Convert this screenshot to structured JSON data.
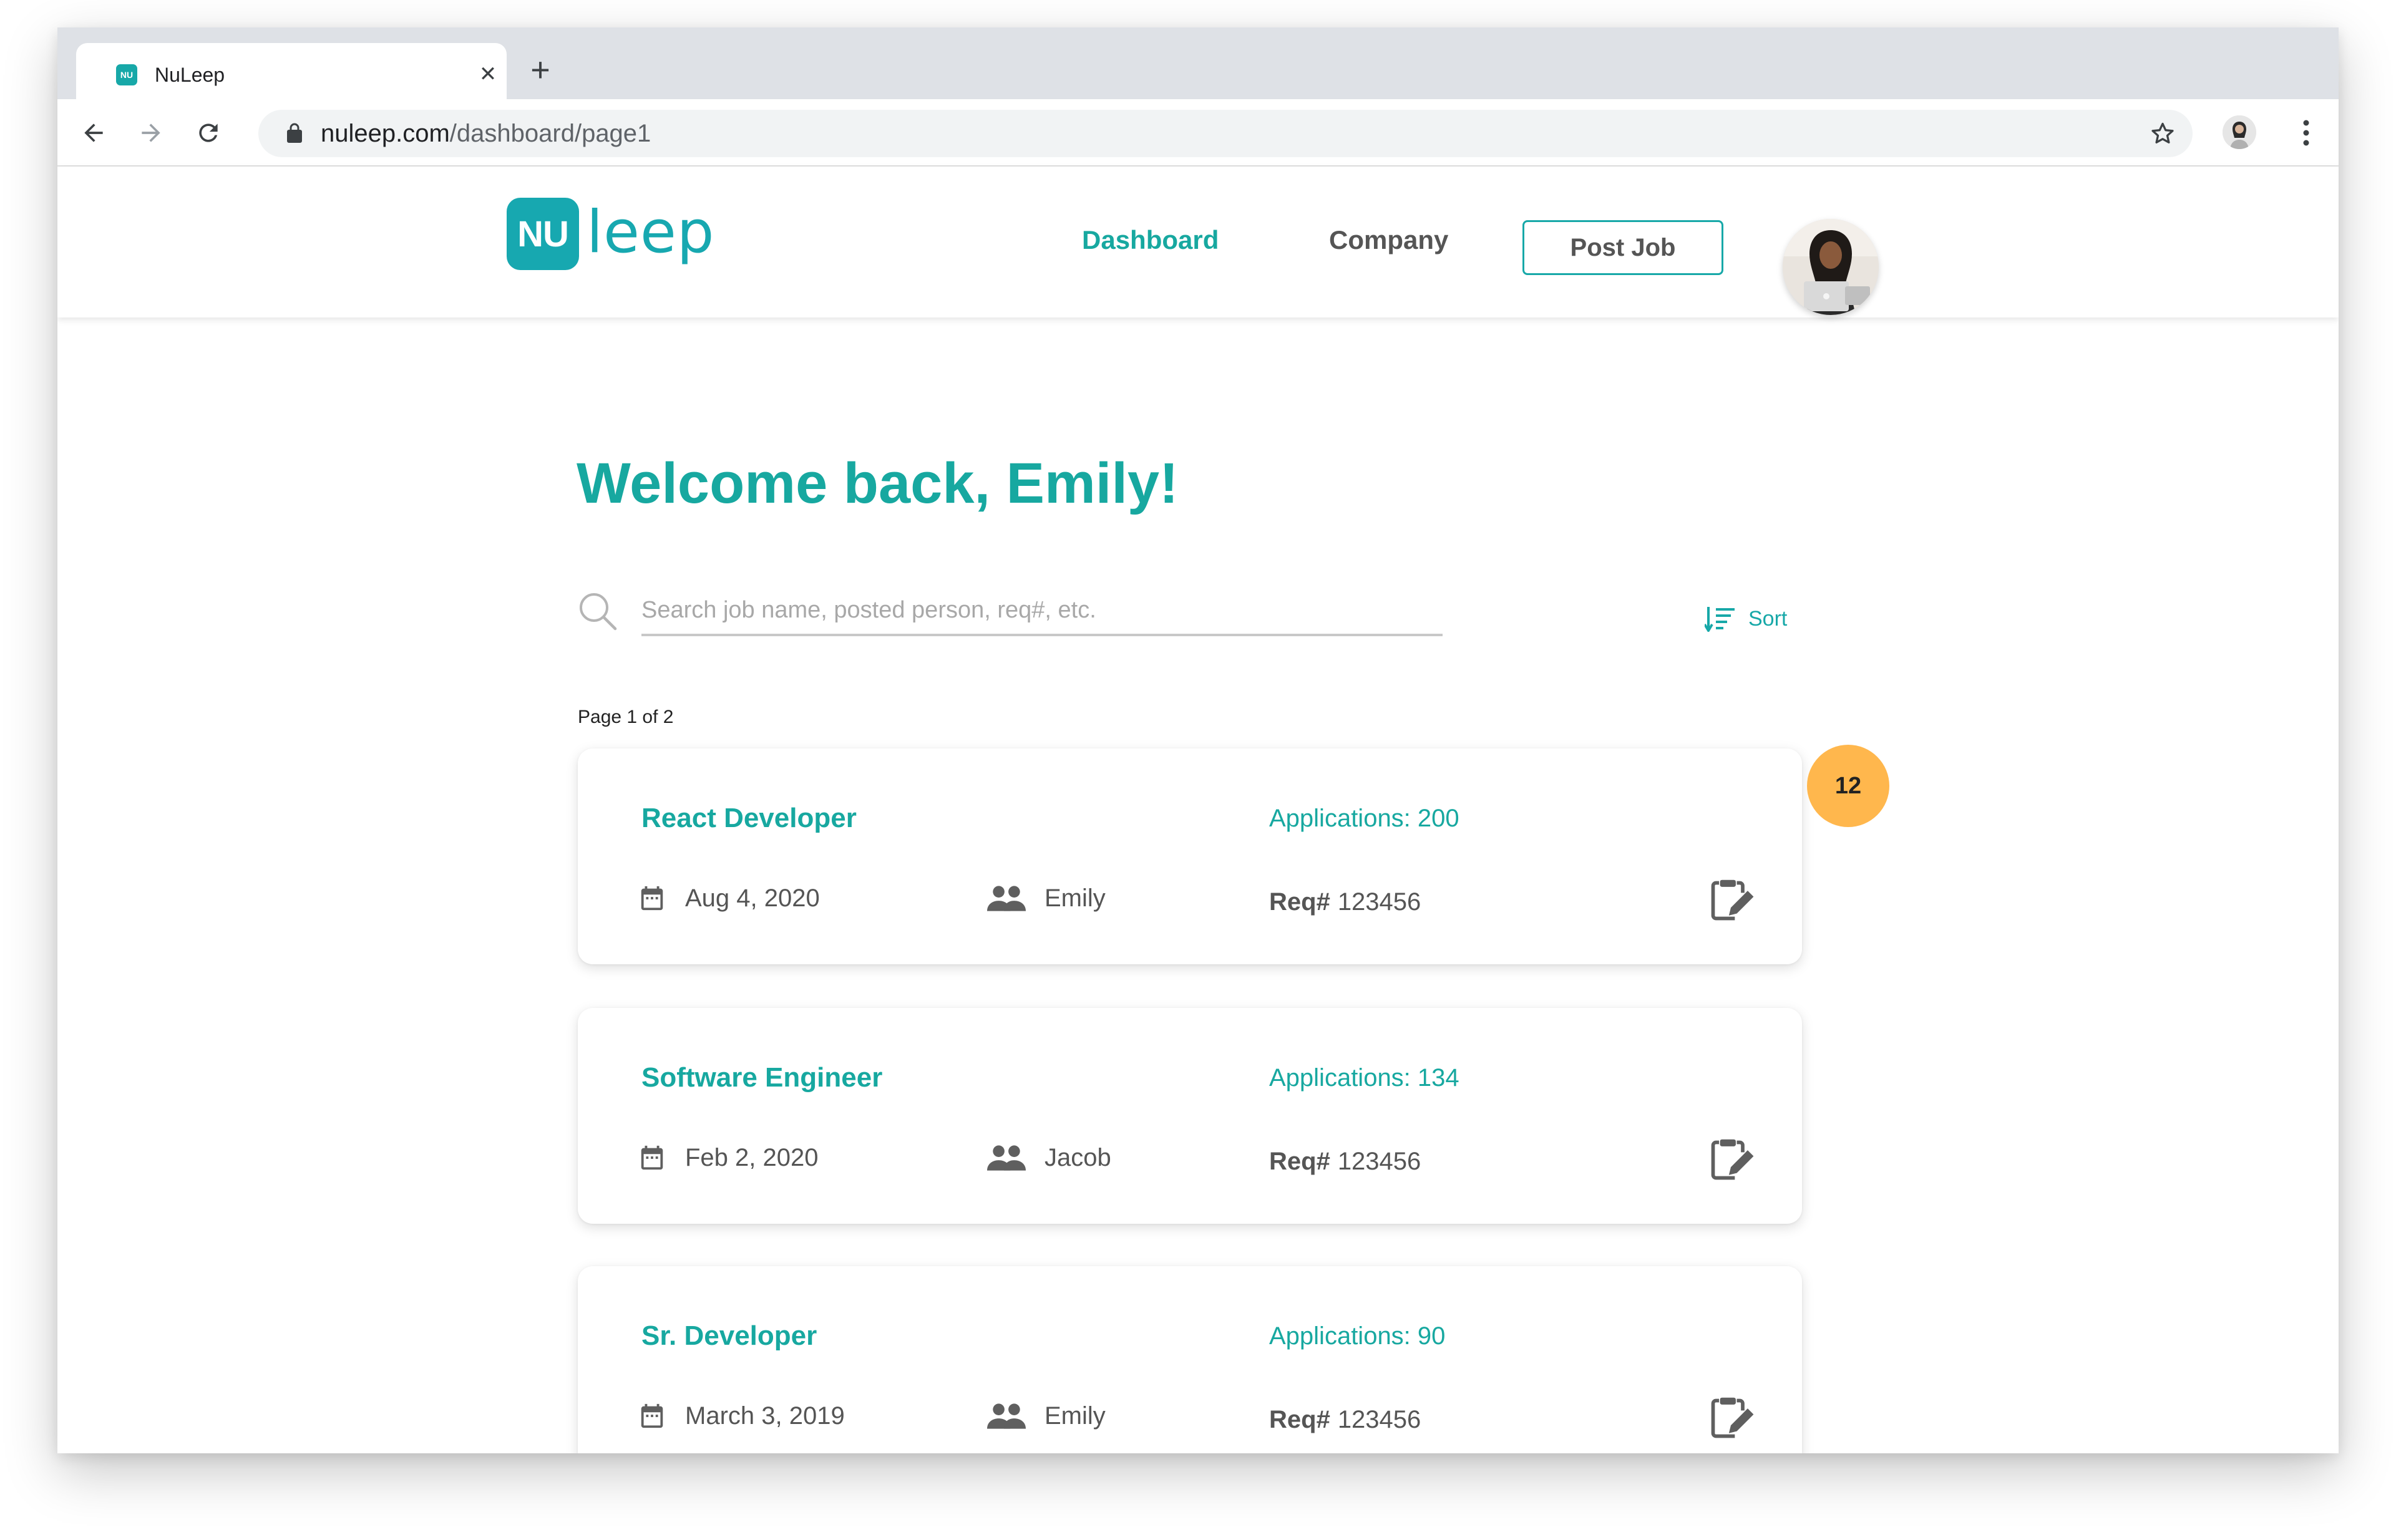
{
  "browser": {
    "tab_title": "NuLeep",
    "favicon_text": "NU",
    "tab_close": "✕",
    "new_tab": "+",
    "url_host": "nuleep.com",
    "url_path": "/dashboard/page1"
  },
  "header": {
    "logo_badge": "NU",
    "logo_text": "leep",
    "nav": {
      "dashboard": "Dashboard",
      "company": "Company"
    },
    "post_job": "Post Job"
  },
  "main": {
    "welcome": "Welcome back, Emily!",
    "search_placeholder": "Search job name, posted person, req#, etc.",
    "sort_label": "Sort",
    "page_info": "Page 1 of 2",
    "badge_count": "12",
    "jobs": [
      {
        "title": "React Developer",
        "applications": "Applications: 200",
        "date": "Aug 4, 2020",
        "posted_by": "Emily",
        "req_label": "Req#",
        "req": "123456"
      },
      {
        "title": "Software Engineer",
        "applications": "Applications: 134",
        "date": "Feb 2, 2020",
        "posted_by": "Jacob",
        "req_label": "Req#",
        "req": "123456"
      },
      {
        "title": "Sr. Developer",
        "applications": "Applications: 90",
        "date": "March 3, 2019",
        "posted_by": "Emily",
        "req_label": "Req#",
        "req": "123456"
      }
    ]
  },
  "colors": {
    "brand_teal": "#17a8a0",
    "badge_orange": "#ffb74d",
    "muted_text": "#555555"
  }
}
